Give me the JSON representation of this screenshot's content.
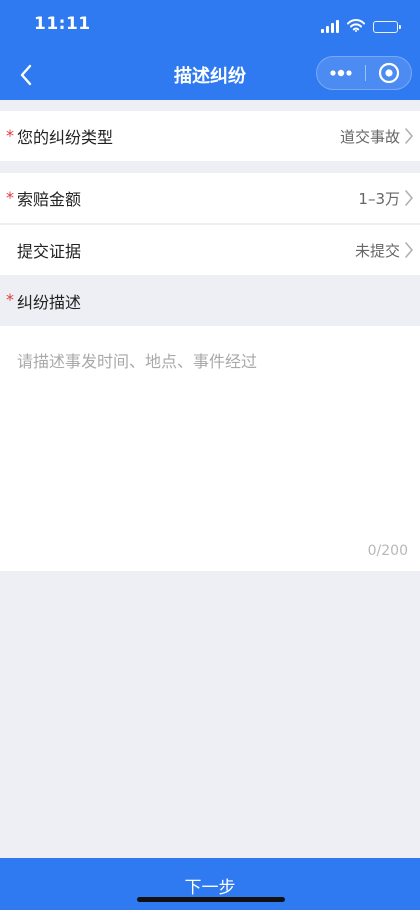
{
  "status_bar": {
    "time": "11:11"
  },
  "nav": {
    "title": "描述纠纷"
  },
  "colors": {
    "primary": "#2f7af0",
    "required": "#e0393c",
    "background": "#eeeff4"
  },
  "icons": [
    "back-arrow-icon",
    "more-dots-icon",
    "close-target-icon",
    "chevron-right-icon",
    "signal-icon",
    "wifi-icon",
    "battery-icon"
  ],
  "form": {
    "dispute_type": {
      "required_mark": "*",
      "label": "您的纠纷类型",
      "value": "道交事故"
    },
    "claim_amount": {
      "required_mark": "*",
      "label": "索赔金额",
      "value": "1–3万"
    },
    "evidence": {
      "label": "提交证据",
      "value": "未提交"
    },
    "description": {
      "required_mark": "*",
      "label": "纠纷描述",
      "placeholder": "请描述事发时间、地点、事件经过",
      "value": "",
      "counter": "0/200"
    }
  },
  "footer": {
    "next_label": "下一步"
  }
}
